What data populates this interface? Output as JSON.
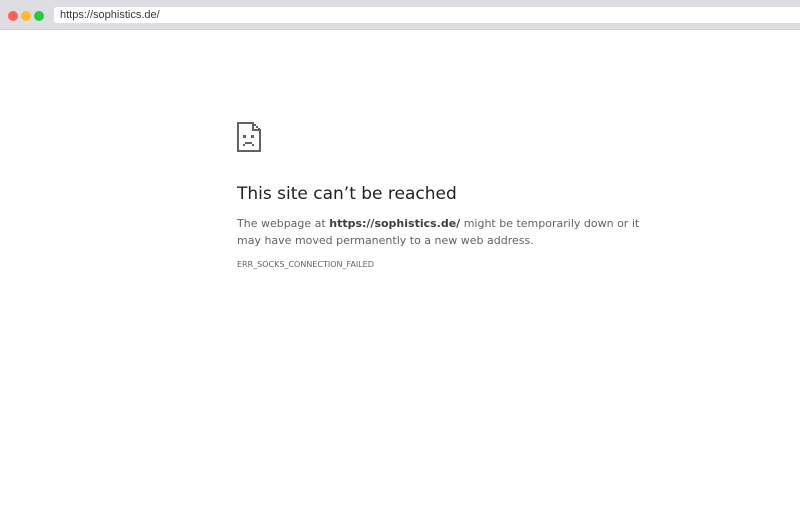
{
  "browser": {
    "url": "https://sophistics.de/",
    "traffic_lights": {
      "close_color": "#ff5f57",
      "minimize_color": "#febc2e",
      "maximize_color": "#28c840"
    }
  },
  "error_page": {
    "icon": "sad-page-icon",
    "title": "This site can’t be reached",
    "description_prefix": "The webpage at ",
    "description_url": "https://sophistics.de/",
    "description_suffix": " might be temporarily down or it may have moved permanently to a new web address.",
    "error_code": "ERR_SOCKS_CONNECTION_FAILED"
  }
}
